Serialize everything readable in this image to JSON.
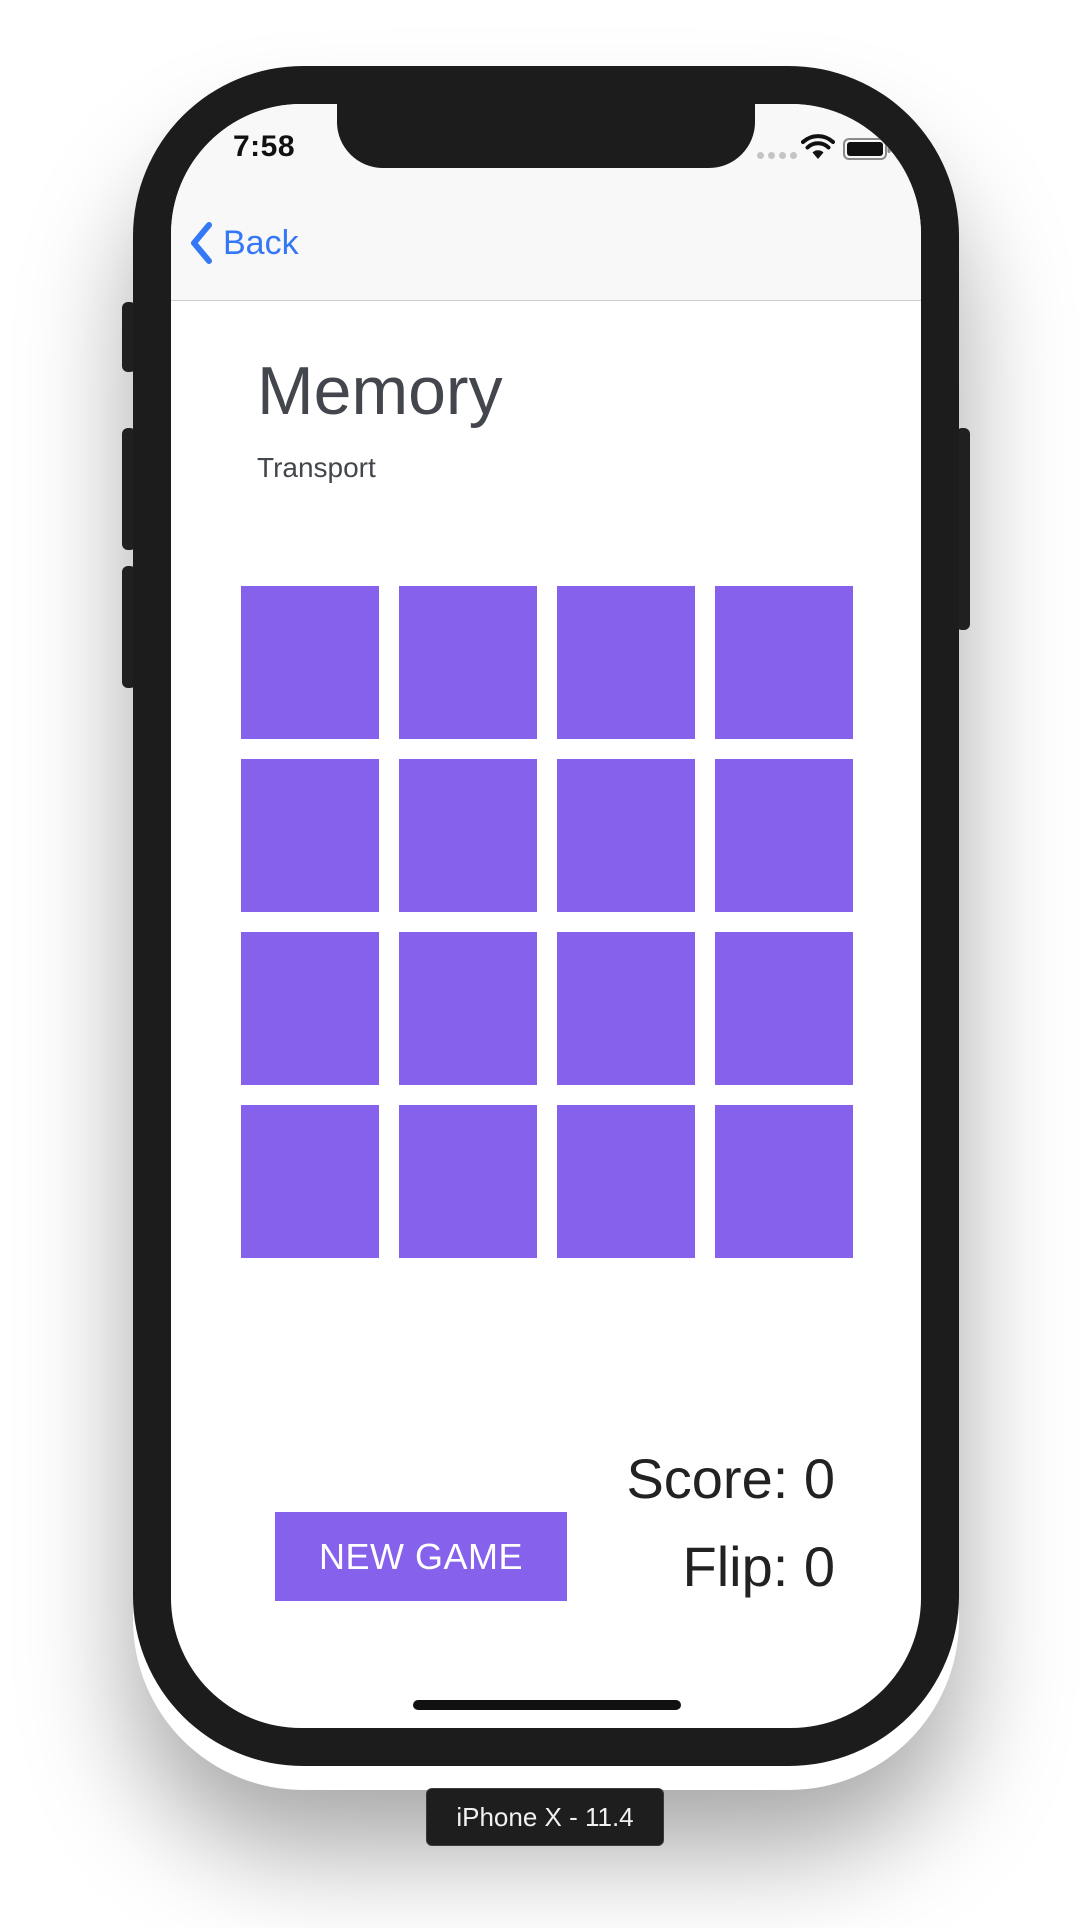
{
  "status_bar": {
    "time": "7:58",
    "icons": [
      "cellular-signal-icon",
      "wifi-icon",
      "battery-icon"
    ]
  },
  "nav": {
    "back_label": "Back",
    "accent_color": "#3478f6"
  },
  "game": {
    "title": "Memory",
    "subtitle": "Transport",
    "card_color": "#8662ec",
    "grid_rows": 4,
    "grid_cols": 4,
    "cards_face_down": 16
  },
  "controls": {
    "new_game_label": "NEW GAME",
    "score_text": "Score: 0",
    "flip_text": "Flip: 0"
  },
  "simulator": {
    "device_label": "iPhone X - 11.4"
  }
}
